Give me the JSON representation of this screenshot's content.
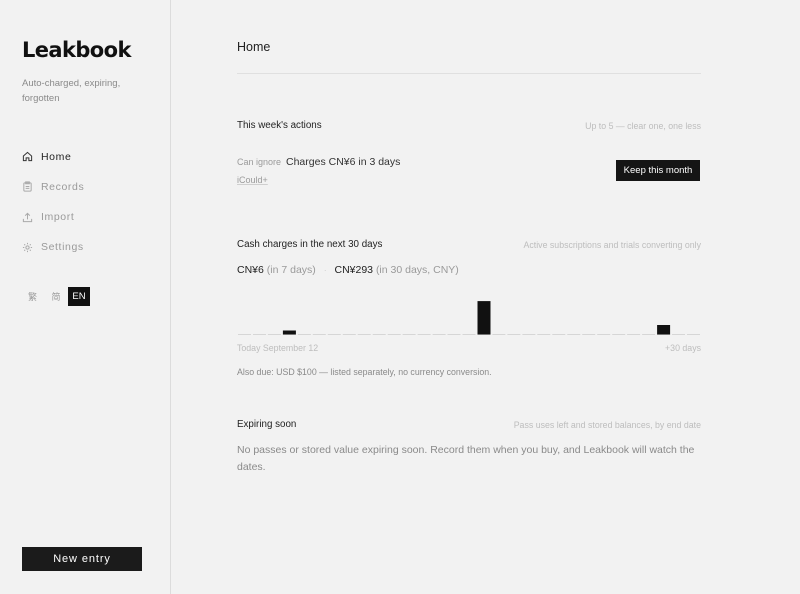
{
  "app": {
    "name": "Leakbook",
    "tagline": "Auto-charged, expiring, forgotten"
  },
  "sidebar": {
    "items": [
      {
        "label": "Home",
        "icon": "home-icon",
        "active": true
      },
      {
        "label": "Records",
        "icon": "clipboard-icon",
        "active": false
      },
      {
        "label": "Import",
        "icon": "upload-icon",
        "active": false
      },
      {
        "label": "Settings",
        "icon": "gear-icon",
        "active": false
      }
    ],
    "languages": [
      "繁",
      "简",
      "EN"
    ],
    "selected_language": "EN",
    "new_entry_label": "New entry"
  },
  "main": {
    "title": "Home",
    "actions": {
      "title": "This week's actions",
      "note": "Up to 5 — clear one, one less",
      "tag": "Can ignore",
      "text": "Charges CN¥6 in 3 days",
      "service": "iCould+",
      "button": "Keep this month"
    },
    "charges": {
      "title": "Cash charges in the next 30 days",
      "note": "Active subscriptions and trials converting only",
      "total1_amount": "CN¥6",
      "total1_detail": "(in 7 days)",
      "separator": "·",
      "total2_amount": "CN¥293",
      "total2_detail": "(in 30 days, CNY)",
      "start_label": "Today September 12",
      "end_label": "+30 days",
      "also_due": "Also due: USD $100 — listed separately, no currency conversion."
    },
    "expiring": {
      "title": "Expiring soon",
      "note": "Pass uses left and stored balances, by end date",
      "empty": "No passes or stored value expiring soon. Record them when you buy, and Leakbook will watch the dates."
    }
  },
  "chart_data": {
    "type": "bar",
    "x": [
      0,
      1,
      2,
      3,
      4,
      5,
      6,
      7,
      8,
      9,
      10,
      11,
      12,
      13,
      14,
      15,
      16,
      17,
      18,
      19,
      20,
      21,
      22,
      23,
      24,
      25,
      26,
      27,
      28,
      29,
      30
    ],
    "values": [
      0,
      0,
      0,
      6,
      0,
      0,
      0,
      0,
      0,
      0,
      0,
      0,
      0,
      0,
      0,
      0,
      228,
      0,
      0,
      0,
      0,
      0,
      0,
      0,
      0,
      0,
      0,
      0,
      65,
      0,
      0
    ],
    "ylim": [
      0,
      300
    ],
    "colors": {
      "bar": "#111111",
      "baseline": "#d6d6d6"
    }
  }
}
